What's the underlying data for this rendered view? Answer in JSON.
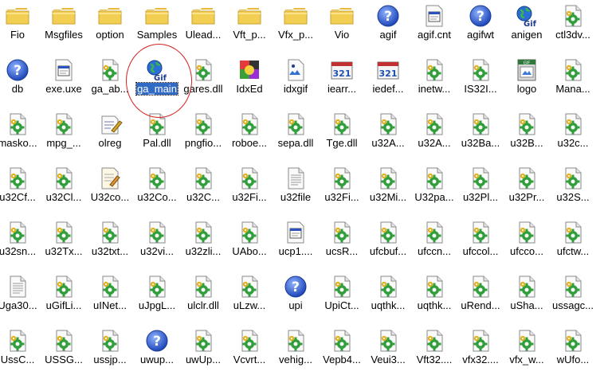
{
  "colors": {
    "selection_bg": "#316ac5",
    "annotation": "#d42020",
    "folder": "#f2cf52",
    "help_blue": "#2f60cf"
  },
  "annotation": {
    "shape": "circle",
    "target": "ga_main"
  },
  "rows": [
    [
      {
        "label": "Fio",
        "icon": "folder-icon"
      },
      {
        "label": "Msgfiles",
        "icon": "folder-icon"
      },
      {
        "label": "option",
        "icon": "folder-icon"
      },
      {
        "label": "Samples",
        "icon": "folder-icon"
      },
      {
        "label": "Ulead...",
        "icon": "folder-icon"
      },
      {
        "label": "Vft_p...",
        "icon": "folder-icon"
      },
      {
        "label": "Vfx_p...",
        "icon": "folder-icon"
      },
      {
        "label": "Vio",
        "icon": "folder-icon"
      },
      {
        "label": "agif",
        "icon": "help-icon"
      },
      {
        "label": "agif.cnt",
        "icon": "window-file-icon"
      },
      {
        "label": "agifwt",
        "icon": "help-icon"
      },
      {
        "label": "anigen",
        "icon": "globe-gif-icon"
      },
      {
        "label": "ctl3dv...",
        "icon": "dll-icon"
      }
    ],
    [
      {
        "label": "db",
        "icon": "help-icon"
      },
      {
        "label": "exe.uxe",
        "icon": "window-file-icon"
      },
      {
        "label": "ga_ab...",
        "icon": "dll-icon"
      },
      {
        "label": "ga_main",
        "icon": "globe-gif-icon",
        "selected": true
      },
      {
        "label": "gares.dll",
        "icon": "dll-icon"
      },
      {
        "label": "IdxEd",
        "icon": "idxed-icon"
      },
      {
        "label": "idxgif",
        "icon": "idxgif-icon"
      },
      {
        "label": "iearr...",
        "icon": "numbered-icon"
      },
      {
        "label": "iedef...",
        "icon": "numbered-icon"
      },
      {
        "label": "inetw...",
        "icon": "dll-icon"
      },
      {
        "label": "IS32I...",
        "icon": "dll-icon"
      },
      {
        "label": "logo",
        "icon": "logo-gif-icon"
      },
      {
        "label": "Mana...",
        "icon": "dll-icon"
      }
    ],
    [
      {
        "label": "masko...",
        "icon": "dll-icon"
      },
      {
        "label": "mpg_...",
        "icon": "dll-icon"
      },
      {
        "label": "olreg",
        "icon": "olreg-icon"
      },
      {
        "label": "Pal.dll",
        "icon": "dll-icon"
      },
      {
        "label": "pngfio...",
        "icon": "dll-icon"
      },
      {
        "label": "roboe...",
        "icon": "dll-icon"
      },
      {
        "label": "sepa.dll",
        "icon": "dll-icon"
      },
      {
        "label": "Tge.dll",
        "icon": "dll-icon"
      },
      {
        "label": "u32A...",
        "icon": "dll-icon"
      },
      {
        "label": "u32A...",
        "icon": "dll-icon"
      },
      {
        "label": "u32Ba...",
        "icon": "dll-icon"
      },
      {
        "label": "u32B...",
        "icon": "dll-icon"
      },
      {
        "label": "u32c...",
        "icon": "dll-icon"
      }
    ],
    [
      {
        "label": "u32Cf...",
        "icon": "dll-icon"
      },
      {
        "label": "u32Cl...",
        "icon": "dll-icon"
      },
      {
        "label": "U32co...",
        "icon": "paint-doc-icon"
      },
      {
        "label": "u32Co...",
        "icon": "dll-icon"
      },
      {
        "label": "u32C...",
        "icon": "dll-icon"
      },
      {
        "label": "u32Fi...",
        "icon": "dll-icon"
      },
      {
        "label": "u32file",
        "icon": "text-doc-icon"
      },
      {
        "label": "u32Fi...",
        "icon": "dll-icon"
      },
      {
        "label": "u32Mi...",
        "icon": "dll-icon"
      },
      {
        "label": "U32pa...",
        "icon": "dll-icon"
      },
      {
        "label": "u32Pl...",
        "icon": "dll-icon"
      },
      {
        "label": "u32Pr...",
        "icon": "dll-icon"
      },
      {
        "label": "u32S...",
        "icon": "dll-icon"
      }
    ],
    [
      {
        "label": "u32sn...",
        "icon": "dll-icon"
      },
      {
        "label": "u32Tx...",
        "icon": "dll-icon"
      },
      {
        "label": "u32txt...",
        "icon": "dll-icon"
      },
      {
        "label": "u32vi...",
        "icon": "dll-icon"
      },
      {
        "label": "u32zli...",
        "icon": "dll-icon"
      },
      {
        "label": "UAbo...",
        "icon": "dll-icon"
      },
      {
        "label": "ucp1....",
        "icon": "window-file-icon"
      },
      {
        "label": "ucsR...",
        "icon": "dll-icon"
      },
      {
        "label": "ufcbuf...",
        "icon": "dll-icon"
      },
      {
        "label": "ufccn...",
        "icon": "dll-icon"
      },
      {
        "label": "ufccol...",
        "icon": "dll-icon"
      },
      {
        "label": "ufcco...",
        "icon": "dll-icon"
      },
      {
        "label": "ufctw...",
        "icon": "dll-icon"
      }
    ],
    [
      {
        "label": "Uga30...",
        "icon": "text-doc-icon"
      },
      {
        "label": "uGifLi...",
        "icon": "dll-icon"
      },
      {
        "label": "uINet...",
        "icon": "dll-icon"
      },
      {
        "label": "uJpgL...",
        "icon": "dll-icon"
      },
      {
        "label": "ulclr.dll",
        "icon": "dll-icon"
      },
      {
        "label": "uLzw...",
        "icon": "dll-icon"
      },
      {
        "label": "upi",
        "icon": "help-icon"
      },
      {
        "label": "UpiCt...",
        "icon": "dll-icon"
      },
      {
        "label": "uqthk...",
        "icon": "dll-icon"
      },
      {
        "label": "uqthk...",
        "icon": "dll-icon"
      },
      {
        "label": "uRend...",
        "icon": "dll-icon"
      },
      {
        "label": "uSha...",
        "icon": "dll-icon"
      },
      {
        "label": "ussagc...",
        "icon": "dll-icon"
      }
    ],
    [
      {
        "label": "UssC...",
        "icon": "dll-icon"
      },
      {
        "label": "USSG...",
        "icon": "dll-icon"
      },
      {
        "label": "ussjp...",
        "icon": "dll-icon"
      },
      {
        "label": "uwup...",
        "icon": "help-icon"
      },
      {
        "label": "uwUp...",
        "icon": "dll-icon"
      },
      {
        "label": "Vcvrt...",
        "icon": "dll-icon"
      },
      {
        "label": "vehig...",
        "icon": "dll-icon"
      },
      {
        "label": "Vepb4...",
        "icon": "dll-icon"
      },
      {
        "label": "Veui3...",
        "icon": "dll-icon"
      },
      {
        "label": "Vft32....",
        "icon": "dll-icon"
      },
      {
        "label": "vfx32....",
        "icon": "dll-icon"
      },
      {
        "label": "vfx_w...",
        "icon": "dll-icon"
      },
      {
        "label": "wUfo...",
        "icon": "dll-icon"
      }
    ]
  ]
}
